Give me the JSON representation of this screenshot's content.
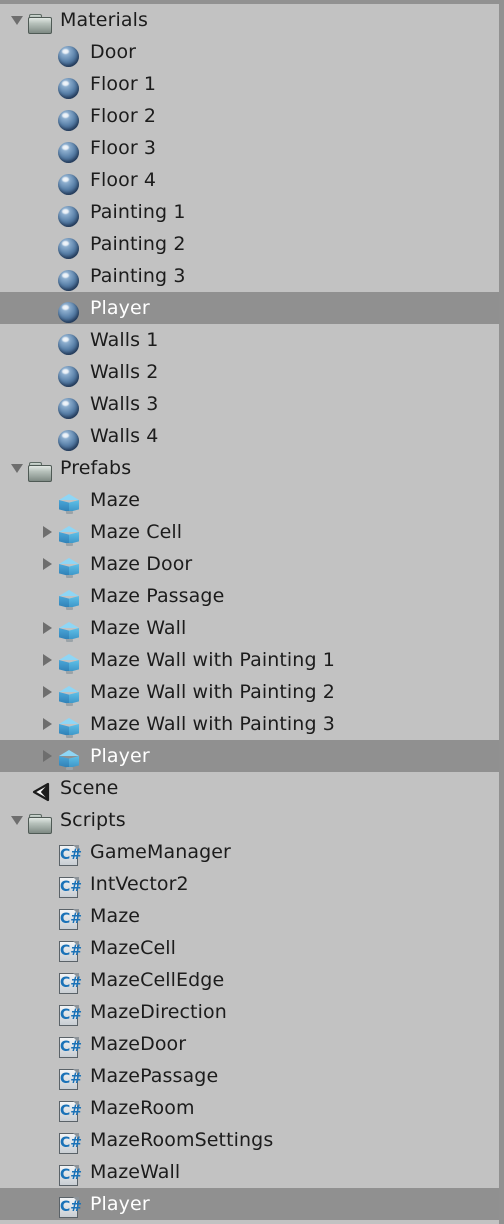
{
  "panel": {
    "name": "Unity Project Assets Hierarchy",
    "background_color": "#c2c2c2",
    "selected_row_color": "#909090",
    "selected_text_color": "#ffffff",
    "text_color": "#1c1c1c"
  },
  "rows": [
    {
      "label": "Materials",
      "icon": "folder-icon",
      "level": 0,
      "arrow": "expanded",
      "selected": false
    },
    {
      "label": "Door",
      "icon": "material-sphere-icon",
      "level": 1,
      "arrow": "none",
      "selected": false
    },
    {
      "label": "Floor 1",
      "icon": "material-sphere-icon",
      "level": 1,
      "arrow": "none",
      "selected": false
    },
    {
      "label": "Floor 2",
      "icon": "material-sphere-icon",
      "level": 1,
      "arrow": "none",
      "selected": false
    },
    {
      "label": "Floor 3",
      "icon": "material-sphere-icon",
      "level": 1,
      "arrow": "none",
      "selected": false
    },
    {
      "label": "Floor 4",
      "icon": "material-sphere-icon",
      "level": 1,
      "arrow": "none",
      "selected": false
    },
    {
      "label": "Painting 1",
      "icon": "material-sphere-icon",
      "level": 1,
      "arrow": "none",
      "selected": false
    },
    {
      "label": "Painting 2",
      "icon": "material-sphere-icon",
      "level": 1,
      "arrow": "none",
      "selected": false
    },
    {
      "label": "Painting 3",
      "icon": "material-sphere-icon",
      "level": 1,
      "arrow": "none",
      "selected": false
    },
    {
      "label": "Player",
      "icon": "material-sphere-icon",
      "level": 1,
      "arrow": "none",
      "selected": true
    },
    {
      "label": "Walls 1",
      "icon": "material-sphere-icon",
      "level": 1,
      "arrow": "none",
      "selected": false
    },
    {
      "label": "Walls 2",
      "icon": "material-sphere-icon",
      "level": 1,
      "arrow": "none",
      "selected": false
    },
    {
      "label": "Walls 3",
      "icon": "material-sphere-icon",
      "level": 1,
      "arrow": "none",
      "selected": false
    },
    {
      "label": "Walls 4",
      "icon": "material-sphere-icon",
      "level": 1,
      "arrow": "none",
      "selected": false
    },
    {
      "label": "Prefabs",
      "icon": "folder-icon",
      "level": 0,
      "arrow": "expanded",
      "selected": false
    },
    {
      "label": "Maze",
      "icon": "prefab-cube-icon",
      "level": 1,
      "arrow": "none",
      "selected": false
    },
    {
      "label": "Maze Cell",
      "icon": "prefab-cube-icon",
      "level": 1,
      "arrow": "collapsed",
      "selected": false
    },
    {
      "label": "Maze Door",
      "icon": "prefab-cube-icon",
      "level": 1,
      "arrow": "collapsed",
      "selected": false
    },
    {
      "label": "Maze Passage",
      "icon": "prefab-cube-icon",
      "level": 1,
      "arrow": "none",
      "selected": false
    },
    {
      "label": "Maze Wall",
      "icon": "prefab-cube-icon",
      "level": 1,
      "arrow": "collapsed",
      "selected": false
    },
    {
      "label": "Maze Wall with Painting 1",
      "icon": "prefab-cube-icon",
      "level": 1,
      "arrow": "collapsed",
      "selected": false
    },
    {
      "label": "Maze Wall with Painting 2",
      "icon": "prefab-cube-icon",
      "level": 1,
      "arrow": "collapsed",
      "selected": false
    },
    {
      "label": "Maze Wall with Painting 3",
      "icon": "prefab-cube-icon",
      "level": 1,
      "arrow": "collapsed",
      "selected": false
    },
    {
      "label": "Player",
      "icon": "prefab-cube-icon",
      "level": 1,
      "arrow": "collapsed",
      "selected": true
    },
    {
      "label": "Scene",
      "icon": "unity-scene-icon",
      "level": 0,
      "arrow": "none",
      "selected": false
    },
    {
      "label": "Scripts",
      "icon": "folder-icon",
      "level": 0,
      "arrow": "expanded",
      "selected": false
    },
    {
      "label": "GameManager",
      "icon": "csharp-script-icon",
      "level": 1,
      "arrow": "none",
      "selected": false
    },
    {
      "label": "IntVector2",
      "icon": "csharp-script-icon",
      "level": 1,
      "arrow": "none",
      "selected": false
    },
    {
      "label": "Maze",
      "icon": "csharp-script-icon",
      "level": 1,
      "arrow": "none",
      "selected": false
    },
    {
      "label": "MazeCell",
      "icon": "csharp-script-icon",
      "level": 1,
      "arrow": "none",
      "selected": false
    },
    {
      "label": "MazeCellEdge",
      "icon": "csharp-script-icon",
      "level": 1,
      "arrow": "none",
      "selected": false
    },
    {
      "label": "MazeDirection",
      "icon": "csharp-script-icon",
      "level": 1,
      "arrow": "none",
      "selected": false
    },
    {
      "label": "MazeDoor",
      "icon": "csharp-script-icon",
      "level": 1,
      "arrow": "none",
      "selected": false
    },
    {
      "label": "MazePassage",
      "icon": "csharp-script-icon",
      "level": 1,
      "arrow": "none",
      "selected": false
    },
    {
      "label": "MazeRoom",
      "icon": "csharp-script-icon",
      "level": 1,
      "arrow": "none",
      "selected": false
    },
    {
      "label": "MazeRoomSettings",
      "icon": "csharp-script-icon",
      "level": 1,
      "arrow": "none",
      "selected": false
    },
    {
      "label": "MazeWall",
      "icon": "csharp-script-icon",
      "level": 1,
      "arrow": "none",
      "selected": false
    },
    {
      "label": "Player",
      "icon": "csharp-script-icon",
      "level": 1,
      "arrow": "none",
      "selected": true
    }
  ],
  "icons": {
    "csharp_glyph": "C#"
  }
}
